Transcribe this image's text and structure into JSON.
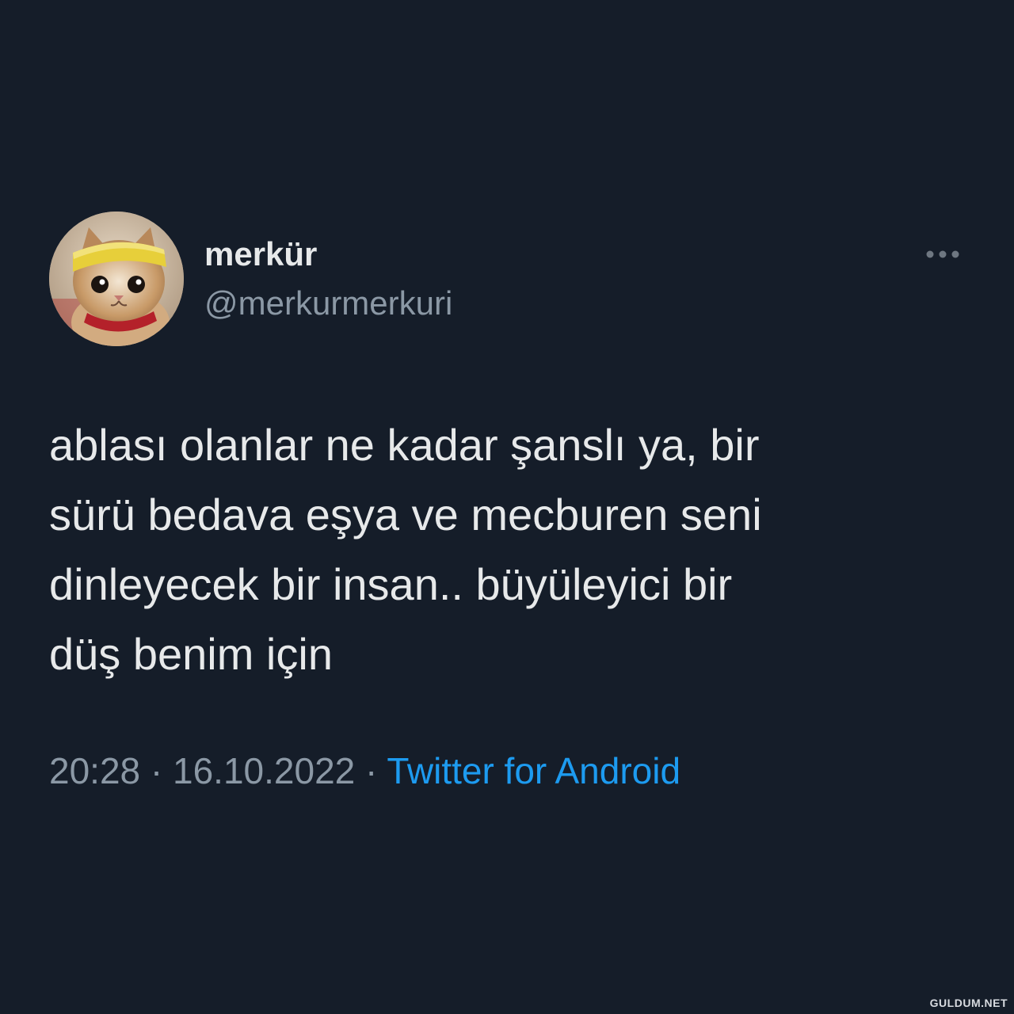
{
  "author": {
    "display_name": "merkür",
    "handle": "@merkurmerkuri",
    "avatar_icon": "kitten-avatar"
  },
  "menu": {
    "icon": "more-options-icon"
  },
  "tweet": {
    "line1": "ablası olanlar ne kadar şanslı ya, bir",
    "line2": "sürü bedava eşya ve mecburen seni",
    "line3": "dinleyecek bir insan.. büyüleyici bir",
    "line4": "düş benim için"
  },
  "meta": {
    "time": "20:28",
    "date": "16.10.2022",
    "separator": "·",
    "source": "Twitter for Android"
  },
  "watermark": "GULDUM.NET",
  "colors": {
    "background": "#151d29",
    "text": "#e7e9ea",
    "secondary": "#8b98a5",
    "link": "#1d9bf0"
  }
}
